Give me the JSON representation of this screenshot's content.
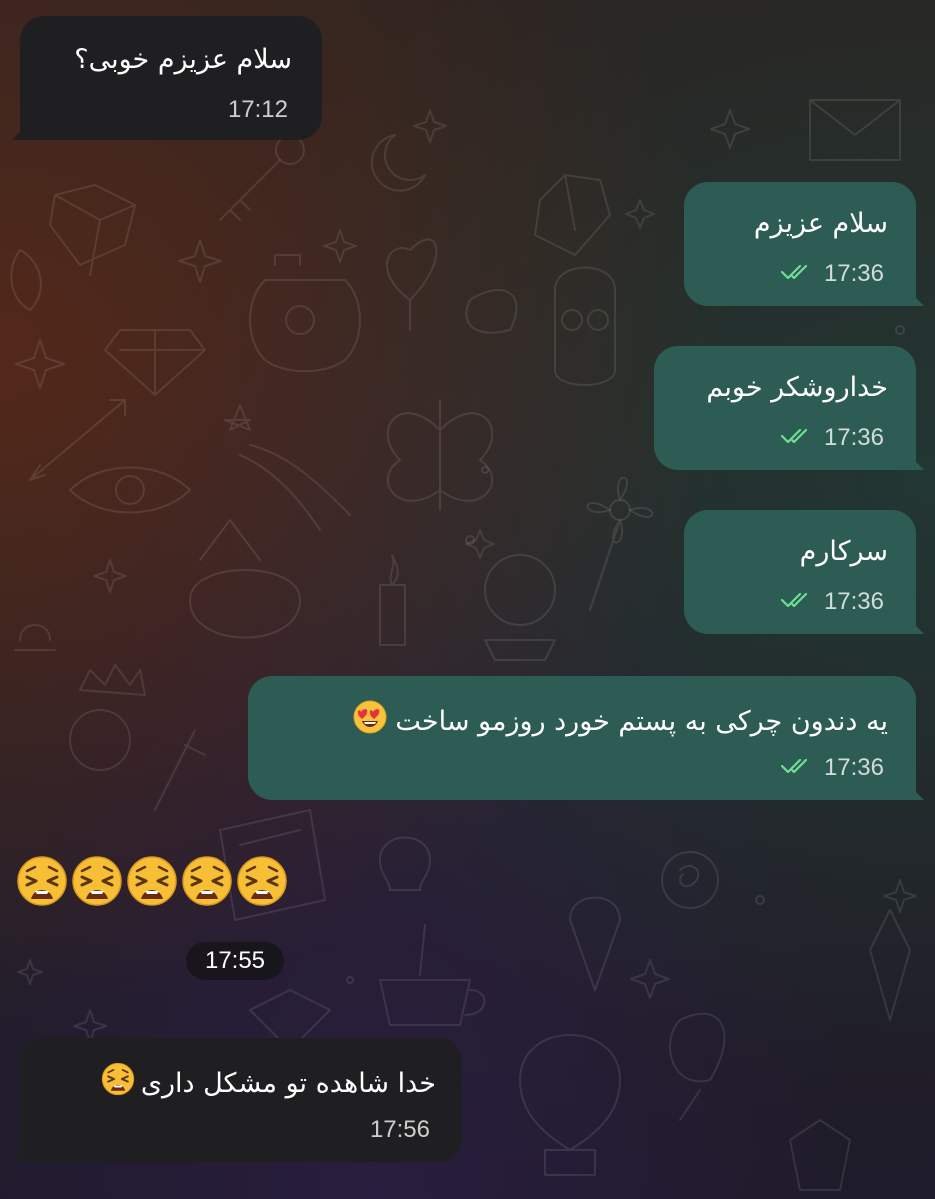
{
  "messages": [
    {
      "direction": "incoming",
      "text": "سلام عزیزم خوبی؟",
      "time": "17:12"
    },
    {
      "direction": "outgoing",
      "text": "سلام عزیزم",
      "time": "17:36",
      "status": "read"
    },
    {
      "direction": "outgoing",
      "text": "خداروشکر خوبم",
      "time": "17:36",
      "status": "read"
    },
    {
      "direction": "outgoing",
      "text": "سرکارم",
      "time": "17:36",
      "status": "read"
    },
    {
      "direction": "outgoing",
      "text": "یه دندون چرکی به پستم خورد روزمو ساخت",
      "emoji": "smiling-face-with-heart-eyes",
      "time": "17:36",
      "status": "read"
    },
    {
      "direction": "incoming",
      "type": "emoji-only",
      "emoji": "weary-face",
      "count": 5,
      "time": "17:55"
    },
    {
      "direction": "incoming",
      "text": "خدا شاهده تو مشکل داری",
      "emoji": "weary-face",
      "time": "17:56"
    }
  ],
  "colors": {
    "incoming_bubble": "#1f1f21",
    "outgoing_bubble": "#2d5c54",
    "read_ticks": "#6ee08f"
  }
}
